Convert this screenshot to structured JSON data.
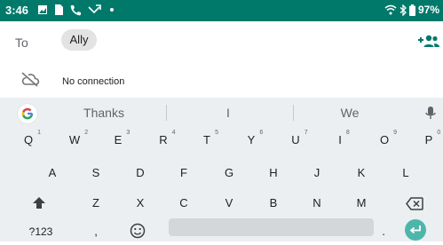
{
  "status_bar": {
    "time": "3:46",
    "battery": "97%"
  },
  "compose": {
    "to_label": "To",
    "recipient_chip": "Ally",
    "connection_status": "No connection"
  },
  "keyboard": {
    "suggestions": [
      "Thanks",
      "I",
      "We"
    ],
    "row1": [
      {
        "key": "Q",
        "hint": "1"
      },
      {
        "key": "W",
        "hint": "2"
      },
      {
        "key": "E",
        "hint": "3"
      },
      {
        "key": "R",
        "hint": "4"
      },
      {
        "key": "T",
        "hint": "5"
      },
      {
        "key": "Y",
        "hint": "6"
      },
      {
        "key": "U",
        "hint": "7"
      },
      {
        "key": "I",
        "hint": "8"
      },
      {
        "key": "O",
        "hint": "9"
      },
      {
        "key": "P",
        "hint": "0"
      }
    ],
    "row2": [
      "A",
      "S",
      "D",
      "F",
      "G",
      "H",
      "J",
      "K",
      "L"
    ],
    "row3": [
      "Z",
      "X",
      "C",
      "V",
      "B",
      "N",
      "M"
    ],
    "symbols_key": "?123",
    "comma_key": ",",
    "period_key": ".",
    "accent_color": "#4db6ac"
  }
}
